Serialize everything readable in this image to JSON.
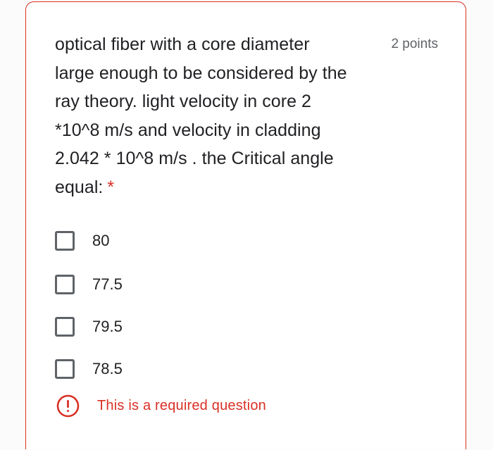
{
  "question": {
    "lines": [
      "optical fiber with a core diameter",
      "large enough to be considered by the",
      "ray theory. light velocity in core 2",
      "*10^8 m/s and velocity in cladding",
      "2.042 * 10^8 m/s . the Critical angle",
      "equal:"
    ],
    "required_marker": "*",
    "points": "2 points"
  },
  "options": [
    {
      "label": "80",
      "checked": false
    },
    {
      "label": "77.5",
      "checked": false
    },
    {
      "label": "79.5",
      "checked": false
    },
    {
      "label": "78.5",
      "checked": false
    }
  ],
  "validation": {
    "icon": "error-icon",
    "message": "This is a required question"
  },
  "colors": {
    "error": "#d93025",
    "text": "#202124",
    "muted": "#5f6368"
  }
}
